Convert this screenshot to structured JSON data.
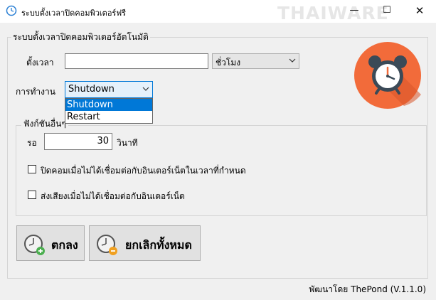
{
  "window": {
    "title": "ระบบตั้งเวลาปิดคอมพิวเตอร์ฟรี",
    "watermark": "THAIWARE",
    "min_glyph": "—",
    "max_glyph": "☐",
    "close_glyph": "✕"
  },
  "main_group": {
    "label": "ระบบตั้งเวลาปิดคอมพิวเตอร์อัตโนมัติ"
  },
  "time": {
    "label": "ตั้งเวลา",
    "value": "",
    "unit_selected": "ชั่วโมง"
  },
  "action": {
    "label": "การทำงาน",
    "selected": "Shutdown",
    "options": [
      "Shutdown",
      "Restart"
    ]
  },
  "other_group": {
    "label": "ฟังก์ชันอื่นๆ",
    "wait_label": "รอ",
    "wait_value": "30",
    "wait_unit": "วินาที",
    "check1_label": "ปิดคอมเมื่อไม่ได้เชื่อมต่อกับอินเตอร์เน็ตในเวลาที่กำหนด",
    "check1_checked": false,
    "check2_label": "ส่งเสียงเมื่อไม่ได้เชื่อมต่อกับอินเตอร์เน็ต",
    "check2_checked": false
  },
  "buttons": {
    "ok_label": "ตกลง",
    "cancel_label": "ยกเลิกทั้งหมด"
  },
  "footer": {
    "credit": "พัฒนาโดย ThePond (V.1.1.0)"
  },
  "colors": {
    "accent": "#0078d7",
    "alarm_bg": "#f26b3a",
    "ok_badge": "#4caf50",
    "cancel_badge": "#f0a020"
  }
}
